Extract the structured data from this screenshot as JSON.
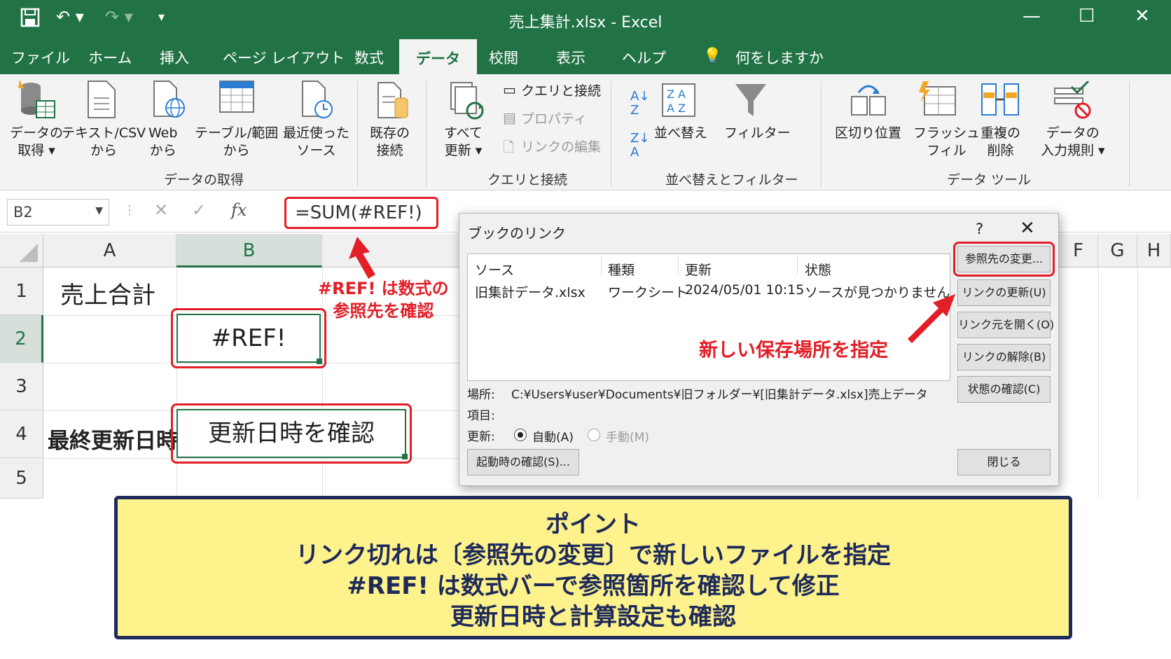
{
  "window": {
    "title": "売上集計.xlsx  -  Excel",
    "minimize": "—",
    "maximize": "☐",
    "close": "✕"
  },
  "menu_tabs": [
    "ファイル",
    "ホーム",
    "挿入",
    "ページ レイアウト",
    "数式",
    "データ",
    "校閲",
    "表示",
    "ヘルプ"
  ],
  "active_tab": "データ",
  "tell_me": "何をしますか",
  "ribbon": {
    "get_data": {
      "line1": "データの",
      "line2": "取得 ▾"
    },
    "text_csv": {
      "line1": "テキスト/CSV",
      "line2": "から"
    },
    "web": {
      "line1": "Web",
      "line2": "から"
    },
    "table_range": {
      "line1": "テーブル/範囲",
      "line2": "から"
    },
    "recent_sources": {
      "line1": "最近使った",
      "line2": "ソース"
    },
    "existing_connections": {
      "line1": "既存の",
      "line2": "接続"
    },
    "group_get_data": "データの取得",
    "refresh_all": {
      "line1": "すべて",
      "line2": "更新 ▾"
    },
    "queries_connections": "クエリと接続",
    "properties": "プロパティ",
    "edit_links": "リンクの編集",
    "group_queries": "クエリと接続",
    "sort": "並べ替え",
    "filter": "フィルター",
    "group_sort_filter": "並べ替えとフィルター",
    "text_to_columns": "区切り位置",
    "flash_fill": {
      "line1": "フラッシュ",
      "line2": "フィル"
    },
    "remove_duplicates": {
      "line1": "重複の",
      "line2": "削除"
    },
    "data_validation": {
      "line1": "データの",
      "line2": "入力規則 ▾"
    },
    "group_data_tools": "データ ツール"
  },
  "formula_bar": {
    "name_box": "B2",
    "formula": "=SUM(#REF!)",
    "fx": "fx"
  },
  "grid": {
    "columns": [
      "A",
      "B",
      "F",
      "G",
      "H"
    ],
    "rows": [
      "1",
      "2",
      "3",
      "4",
      "5"
    ],
    "a1": "売上合計",
    "b2": "#REF!",
    "a4": "最終更新日時",
    "b4": "更新日時を確認"
  },
  "annotations": {
    "ref_line1": "#REF! は数式の",
    "ref_line2": "参照先を確認",
    "new_location": "新しい保存場所を指定"
  },
  "dialog": {
    "title": "ブックのリンク",
    "help": "?",
    "close": "✕",
    "headers": [
      "ソース",
      "種類",
      "更新",
      "状態"
    ],
    "row": {
      "source": "旧集計データ.xlsx",
      "type": "ワークシート",
      "updated": "2024/05/01 10:15",
      "status": "ソースが見つかりません"
    },
    "location_label": "場所:",
    "location_value": "C:¥Users¥user¥Documents¥旧フォルダー¥[旧集計データ.xlsx]売上データ",
    "item_label": "項目:",
    "update_label": "更新:",
    "auto": "自動(A)",
    "manual": "手動(M)",
    "startup_prompt": "起動時の確認(S)...",
    "buttons": [
      "参照先の変更...",
      "リンクの更新(U)",
      "リンク元を開く(O)",
      "リンクの解除(B)",
      "状態の確認(C)"
    ],
    "close_button": "閉じる"
  },
  "point": {
    "title": "ポイント",
    "line1": "リンク切れは〔参照先の変更〕で新しいファイルを指定",
    "line2": "#REF! は数式バーで参照箇所を確認して修正",
    "line3": "更新日時と計算設定も確認"
  },
  "colors": {
    "excel_green": "#217346",
    "highlight_red": "#e21e26",
    "point_bg": "#fdf28c",
    "point_border": "#1e2a5a"
  }
}
